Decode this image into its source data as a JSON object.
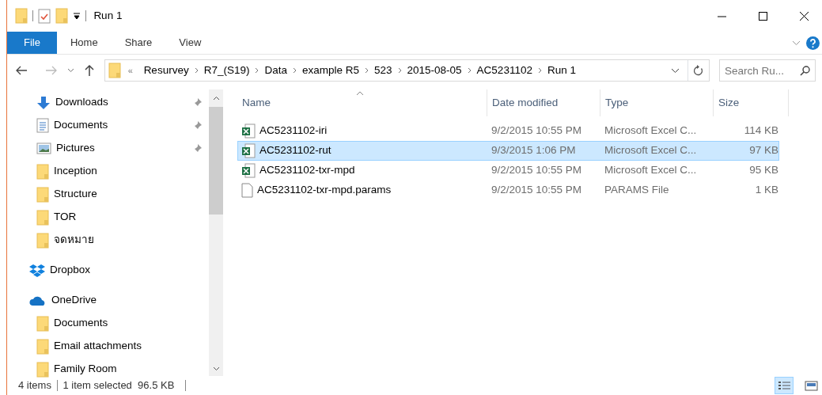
{
  "window": {
    "title": "Run 1"
  },
  "ribbon": {
    "tabs": [
      {
        "label": "File",
        "selected": true
      },
      {
        "label": "Home",
        "selected": false
      },
      {
        "label": "Share",
        "selected": false
      },
      {
        "label": "View",
        "selected": false
      }
    ]
  },
  "address": {
    "overflow": "«",
    "crumbs": [
      "Resurvey",
      "R7_(S19)",
      "Data",
      "example R5",
      "523",
      "2015-08-05",
      "AC5231102",
      "Run 1"
    ],
    "search_placeholder": "Search Ru..."
  },
  "sidebar": {
    "items": [
      {
        "label": "Downloads",
        "kind": "downloads",
        "pinned": true
      },
      {
        "label": "Documents",
        "kind": "documents",
        "pinned": true
      },
      {
        "label": "Pictures",
        "kind": "pictures",
        "pinned": true
      },
      {
        "label": "Inception",
        "kind": "folder",
        "pinned": false
      },
      {
        "label": "Structure",
        "kind": "folder",
        "pinned": false
      },
      {
        "label": "TOR",
        "kind": "folder",
        "pinned": false
      },
      {
        "label": "จดหมาย",
        "kind": "folder",
        "pinned": false
      },
      {
        "label": "Dropbox",
        "kind": "dropbox",
        "pinned": false
      },
      {
        "label": "OneDrive",
        "kind": "onedrive",
        "pinned": false,
        "children": [
          {
            "label": "Documents",
            "kind": "folder",
            "pinned": false
          },
          {
            "label": "Email attachments",
            "kind": "folder",
            "pinned": false
          },
          {
            "label": "Family Room",
            "kind": "folder",
            "pinned": false
          }
        ]
      }
    ]
  },
  "table": {
    "columns": [
      "Name",
      "Date modified",
      "Type",
      "Size"
    ],
    "rows": [
      {
        "name": "AC5231102-iri",
        "kind": "excel",
        "date": "9/2/2015 10:55 PM",
        "type": "Microsoft Excel C...",
        "size": "114 KB",
        "selected": false
      },
      {
        "name": "AC5231102-rut",
        "kind": "excel",
        "date": "9/3/2015 1:06 PM",
        "type": "Microsoft Excel C...",
        "size": "97 KB",
        "selected": true
      },
      {
        "name": "AC5231102-txr-mpd",
        "kind": "excel",
        "date": "9/2/2015 10:55 PM",
        "type": "Microsoft Excel C...",
        "size": "95 KB",
        "selected": false
      },
      {
        "name": "AC5231102-txr-mpd.params",
        "kind": "file",
        "date": "9/2/2015 10:55 PM",
        "type": "PARAMS File",
        "size": "1 KB",
        "selected": false
      }
    ]
  },
  "status_bar": {
    "count": "4 items",
    "selection": "1 item selected  96.5 KB",
    "views": [
      {
        "kind": "details",
        "selected": true
      },
      {
        "kind": "large",
        "selected": false
      }
    ]
  }
}
